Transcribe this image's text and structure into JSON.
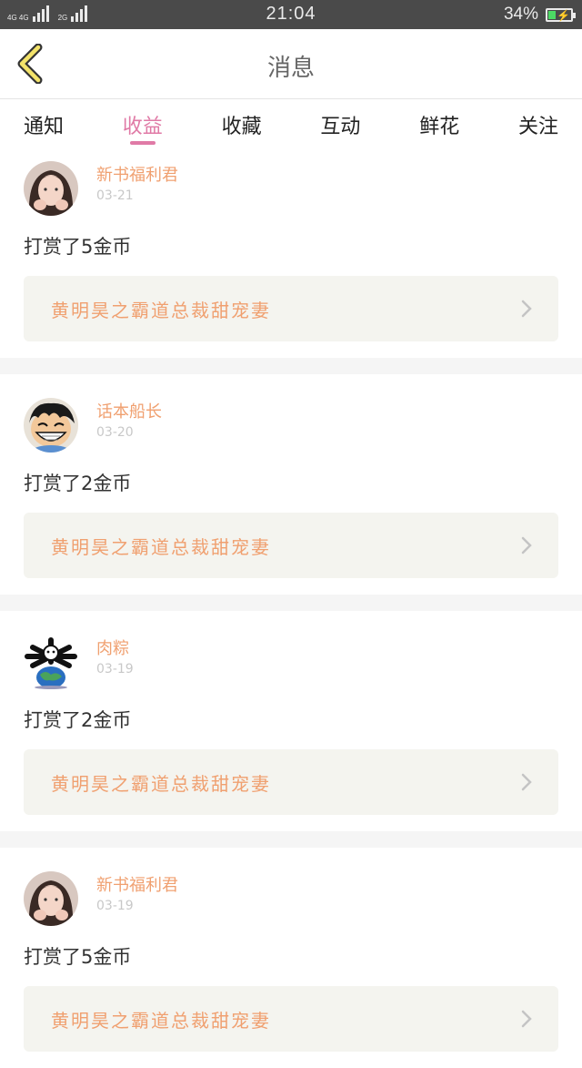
{
  "status": {
    "network1": "4G 4G",
    "network2": "2G",
    "time": "21:04",
    "battery": "34%",
    "battery_level": 0.34
  },
  "header": {
    "title": "消息"
  },
  "tabs": [
    {
      "label": "通知"
    },
    {
      "label": "收益",
      "active": true
    },
    {
      "label": "收藏"
    },
    {
      "label": "互动"
    },
    {
      "label": "鲜花"
    },
    {
      "label": "关注"
    }
  ],
  "items": [
    {
      "user": "新书福利君",
      "date": "03-21",
      "reward": "打赏了5金币",
      "book": "黄明昊之霸道总裁甜宠妻",
      "avatar": "girl-avatar"
    },
    {
      "user": "话本船长",
      "date": "03-20",
      "reward": "打赏了2金币",
      "book": "黄明昊之霸道总裁甜宠妻",
      "avatar": "cartoon-boy-avatar"
    },
    {
      "user": "肉粽",
      "date": "03-19",
      "reward": "打赏了2金币",
      "book": "黄明昊之霸道总裁甜宠妻",
      "avatar": "globe-avatar"
    },
    {
      "user": "新书福利君",
      "date": "03-19",
      "reward": "打赏了5金币",
      "book": "黄明昊之霸道总裁甜宠妻",
      "avatar": "girl-avatar"
    }
  ],
  "colors": {
    "accent": "#e07aa6",
    "username": "#f0a070",
    "card_bg": "#f4f4ef"
  }
}
